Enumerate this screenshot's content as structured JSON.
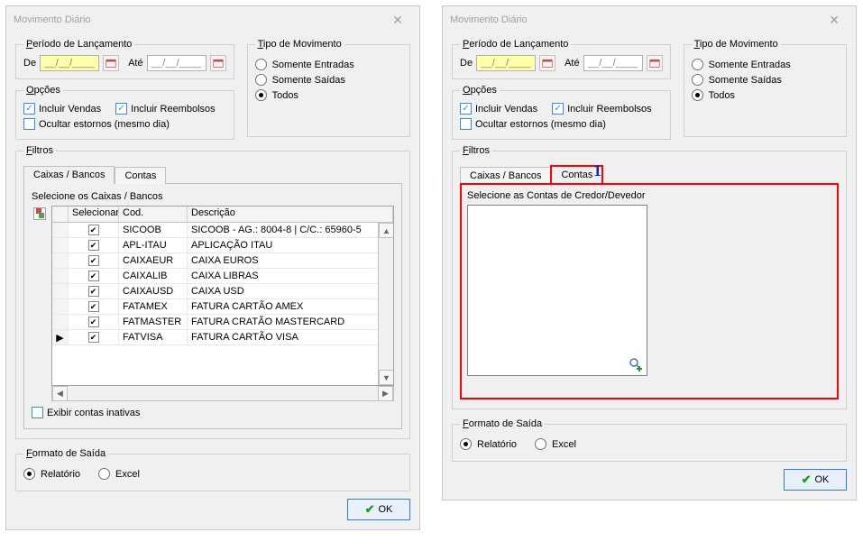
{
  "dialog_title": "Movimento Diário",
  "period": {
    "legend_full": "Período de Lançamento",
    "de_label": "De",
    "ate_label": "Até",
    "date_mask": "__/__/____"
  },
  "options": {
    "legend_full": "Opções",
    "incluir_vendas": "Incluir Vendas",
    "incluir_reembolsos": "Incluir Reembolsos",
    "ocultar_estornos": "Ocultar estornos (mesmo dia)"
  },
  "tipo": {
    "legend_full": "Tipo de Movimento",
    "somente_entradas": "Somente Entradas",
    "somente_saidas": "Somente Saídas",
    "todos": "Todos"
  },
  "filtros_label": "Filtros",
  "tabs": {
    "caixas": "Caixas / Bancos",
    "contas": "Contas"
  },
  "caixas_panel": {
    "label": "Selecione os Caixas / Bancos",
    "headers": {
      "selecionar": "Selecionar",
      "cod": "Cod.",
      "descricao": "Descrição"
    },
    "rows": [
      {
        "cod": "SICOOB",
        "desc": "SICOOB - AG.: 8004-8 | C/C.: 65960-5"
      },
      {
        "cod": "APL-ITAU",
        "desc": "APLICAÇÃO ITAU"
      },
      {
        "cod": "CAIXAEUR",
        "desc": "CAIXA EUROS"
      },
      {
        "cod": "CAIXALIB",
        "desc": "CAIXA LIBRAS"
      },
      {
        "cod": "CAIXAUSD",
        "desc": "CAIXA USD"
      },
      {
        "cod": "FATAMEX",
        "desc": "FATURA CARTÃO AMEX"
      },
      {
        "cod": "FATMASTER",
        "desc": "FATURA CRATÃO MASTERCARD"
      },
      {
        "cod": "FATVISA",
        "desc": "FATURA CARTÃO VISA"
      }
    ],
    "exibir_inativas": "Exibir contas inativas"
  },
  "contas_panel": {
    "label": "Selecione as Contas de Credor/Devedor"
  },
  "formato": {
    "legend_full": "Formato de Saída",
    "relatorio": "Relatório",
    "excel": "Excel"
  },
  "ok_label": "OK",
  "annotation_1": "1"
}
